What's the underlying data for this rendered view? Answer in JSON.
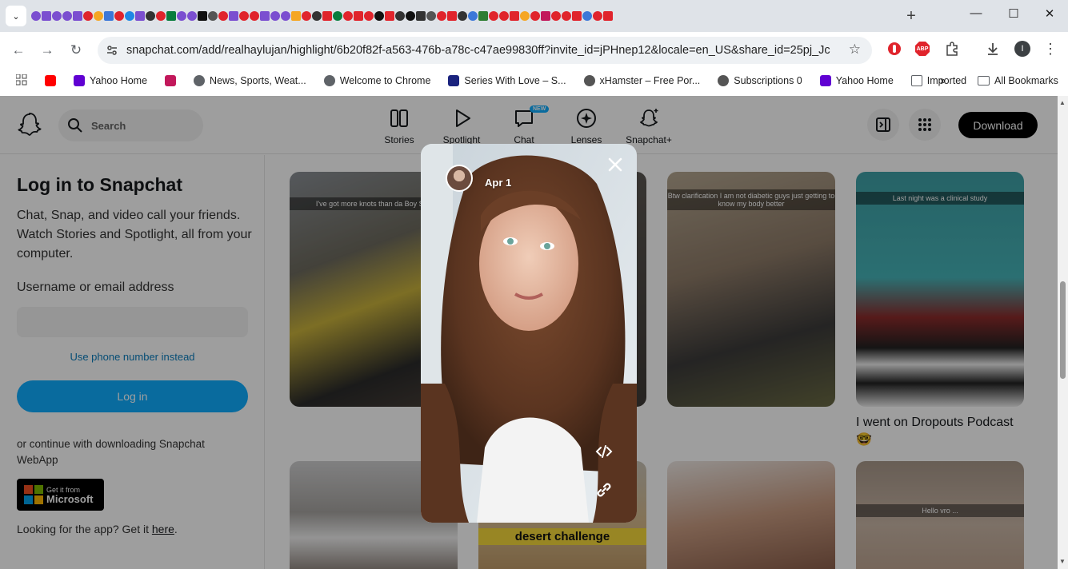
{
  "browser": {
    "url": "snapchat.com/add/realhaylujan/highlight/6b20f82f-a563-476b-a78c-c47ae99830ff?invite_id=jPHnep12&locale=en_US&share_id=25pj_JcuQ7...",
    "bookmarks": [
      {
        "label": "",
        "icon": "youtube-icon",
        "color": "#ff0000"
      },
      {
        "label": "Yahoo Home",
        "icon": "yahoo-icon",
        "color": "#6001d2"
      },
      {
        "label": "",
        "icon": "s-icon",
        "color": "#c2185b"
      },
      {
        "label": "News, Sports, Weat...",
        "icon": "globe-icon",
        "color": "#5f6368"
      },
      {
        "label": "Welcome to Chrome",
        "icon": "globe-icon",
        "color": "#5f6368"
      },
      {
        "label": "Series With Love – S...",
        "icon": "hd-icon",
        "color": "#1a237e"
      },
      {
        "label": "xHamster – Free Por...",
        "icon": "xhamster-icon",
        "color": "#555555"
      },
      {
        "label": "Subscriptions 0",
        "icon": "xhamster-icon",
        "color": "#555555"
      },
      {
        "label": "Yahoo Home",
        "icon": "yahoo-icon",
        "color": "#6001d2"
      },
      {
        "label": "Imported",
        "icon": "folder-icon",
        "color": "#5f6368"
      }
    ],
    "more_bookmarks": "»",
    "all_bookmarks": "All Bookmarks",
    "profile_initial": "I",
    "abp_label": "ABP"
  },
  "header": {
    "search_placeholder": "Search",
    "nav": [
      {
        "label": "Stories",
        "icon": "stories-icon"
      },
      {
        "label": "Spotlight",
        "icon": "spotlight-icon"
      },
      {
        "label": "Chat",
        "icon": "chat-icon",
        "badge": "NEW"
      },
      {
        "label": "Lenses",
        "icon": "lenses-icon"
      },
      {
        "label": "Snapchat+",
        "icon": "snapchat-plus-icon"
      }
    ],
    "download_label": "Download"
  },
  "login": {
    "title": "Log in to Snapchat",
    "description": "Chat, Snap, and video call your friends. Watch Stories and Spotlight, all from your computer.",
    "username_label": "Username or email address",
    "phone_link": "Use phone number instead",
    "login_button": "Log in",
    "or_text": "or continue with downloading Snapchat WebApp",
    "ms_small": "Get it from",
    "ms_big": "Microsoft",
    "get_app_prefix": "Looking for the app? Get it ",
    "get_app_link": "here",
    "get_app_suffix": "."
  },
  "grid": {
    "captions": [
      "I've got more knots than da Boy Sco",
      "Btw clarification I am not diabetic guys just getting to know my body better",
      "Last night was a clinical study",
      "desert challenge",
      "Hello vro ..."
    ],
    "tile_title": "I went on Dropouts Podcast 🤓"
  },
  "viewer": {
    "date": "Apr 1"
  },
  "colors": {
    "snap_blue": "#0fadff",
    "snap_black": "#000000"
  }
}
